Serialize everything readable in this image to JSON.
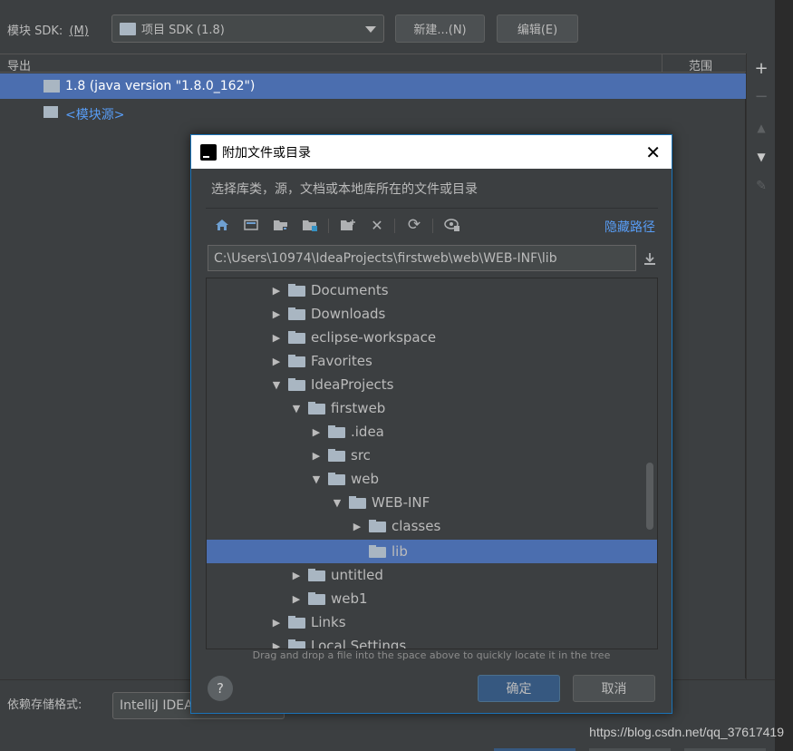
{
  "sdk_row": {
    "label": "模块 SDK:",
    "label_mnemonic": "(M)",
    "selected_sdk": "项目 SDK (1.8)",
    "new_button": "新建...(N)",
    "edit_button": "编辑(E)"
  },
  "table": {
    "col_export": "导出",
    "col_scope": "范围",
    "rows": [
      {
        "label": "1.8 (java version \"1.8.0_162\")",
        "selected": true
      },
      {
        "label": "<模块源>",
        "selected": false
      }
    ]
  },
  "side_tools": [
    "add-icon",
    "remove-icon",
    "move-up-icon",
    "move-down-icon",
    "edit-icon"
  ],
  "dialog": {
    "title": "附加文件或目录",
    "description": "选择库类，源，文档或本地库所在的文件或目录",
    "hide_path_link": "隐藏路径",
    "path": "C:\\Users\\10974\\IdeaProjects\\firstweb\\web\\WEB-INF\\lib",
    "toolbar_icons": [
      "home-icon",
      "desktop-icon",
      "project-folder-icon",
      "module-folder-icon",
      "new-folder-icon",
      "delete-icon",
      "refresh-icon",
      "show-hidden-icon"
    ],
    "tree": [
      {
        "label": "Documents",
        "level": 0,
        "expanded": false
      },
      {
        "label": "Downloads",
        "level": 0,
        "expanded": false
      },
      {
        "label": "eclipse-workspace",
        "level": 0,
        "expanded": false
      },
      {
        "label": "Favorites",
        "level": 0,
        "expanded": false
      },
      {
        "label": "IdeaProjects",
        "level": 0,
        "expanded": true
      },
      {
        "label": "firstweb",
        "level": 1,
        "expanded": true
      },
      {
        "label": ".idea",
        "level": 2,
        "expanded": false
      },
      {
        "label": "src",
        "level": 2,
        "expanded": false
      },
      {
        "label": "web",
        "level": 2,
        "expanded": true
      },
      {
        "label": "WEB-INF",
        "level": 3,
        "expanded": true
      },
      {
        "label": "classes",
        "level": 4,
        "expanded": false
      },
      {
        "label": "lib",
        "level": 4,
        "expanded": null,
        "selected": true
      },
      {
        "label": "untitled",
        "level": 1,
        "expanded": false
      },
      {
        "label": "web1",
        "level": 1,
        "expanded": false
      },
      {
        "label": "Links",
        "level": 0,
        "expanded": false
      },
      {
        "label": "Local Settings",
        "level": 0,
        "expanded": false
      }
    ],
    "hint": "Drag and drop a file into the space above to quickly locate it in the tree",
    "help": "?",
    "ok_button": "确定",
    "cancel_button": "取消"
  },
  "bottom": {
    "storage_label": "依赖存储格式:",
    "storage_value": "IntelliJ IDEA"
  },
  "watermark": "https://blog.csdn.net/qq_37617419"
}
